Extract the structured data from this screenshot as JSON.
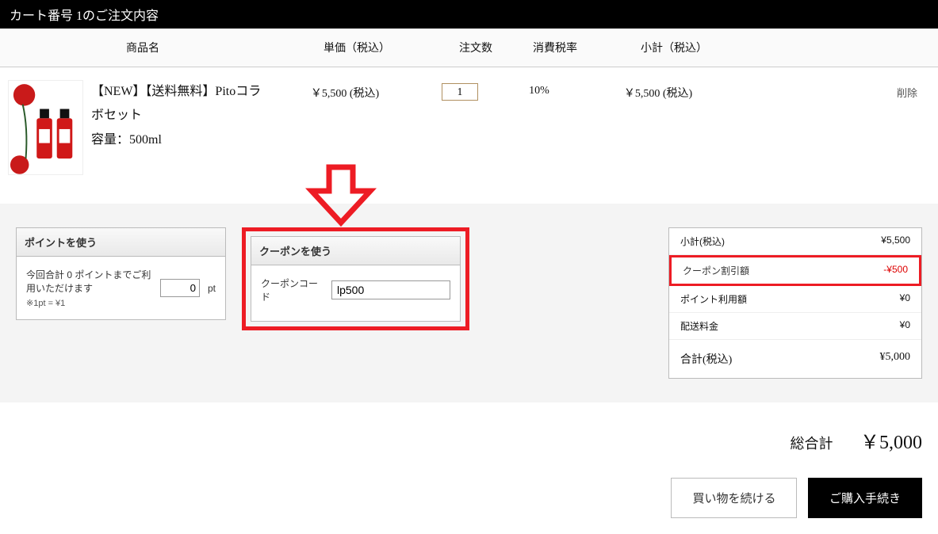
{
  "header": "カート番号 1のご注文内容",
  "columns": {
    "name": "商品名",
    "price": "単価（税込）",
    "qty": "注文数",
    "tax": "消費税率",
    "subtotal": "小計（税込）"
  },
  "item": {
    "title": "【NEW】【送料無料】Pitoコラボセット",
    "spec": "容量：500ml",
    "price": "￥5,500 (税込)",
    "qty": "1",
    "tax": "10%",
    "subtotal": "￥5,500 (税込)",
    "delete": "削除"
  },
  "point": {
    "title": "ポイントを使う",
    "desc": "今回合計 0 ポイントまでご利用いただけます",
    "note": "※1pt = ¥1",
    "value": "0",
    "unit": "pt"
  },
  "coupon": {
    "title": "クーポンを使う",
    "label": "クーポンコード",
    "value": "lp500"
  },
  "summary": {
    "subtotal_label": "小計(税込)",
    "subtotal_value": "¥5,500",
    "coupon_label": "クーポン割引額",
    "coupon_value": "-¥500",
    "point_label": "ポイント利用額",
    "point_value": "¥0",
    "ship_label": "配送料金",
    "ship_value": "¥0",
    "total_label": "合計(税込)",
    "total_value": "¥5,000"
  },
  "grand": {
    "label": "総合計",
    "value": "￥5,000"
  },
  "buttons": {
    "continue": "買い物を続ける",
    "checkout": "ご購入手続き"
  }
}
